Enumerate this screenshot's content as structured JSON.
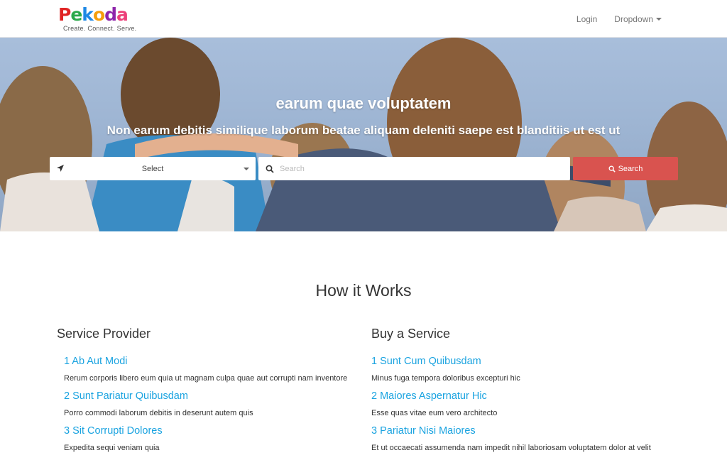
{
  "brand": {
    "letters": [
      {
        "ch": "P",
        "color": "#e02424"
      },
      {
        "ch": "e",
        "color": "#2ba84a"
      },
      {
        "ch": "k",
        "color": "#1e88e5"
      },
      {
        "ch": "o",
        "color": "#f59e0b"
      },
      {
        "ch": "d",
        "color": "#8e24aa"
      },
      {
        "ch": "a",
        "color": "#ec407a"
      }
    ],
    "tagline": "Create. Connect. Serve."
  },
  "nav": {
    "login": "Login",
    "dropdown": "Dropdown"
  },
  "hero": {
    "title": "earum quae voluptatem",
    "subtitle": "Non earum debitis similique laborum beatae aliquam deleniti saepe est blanditiis ut est ut",
    "location_select": "Select",
    "search_placeholder": "Search",
    "search_button": "Search"
  },
  "how": {
    "title": "How it Works",
    "provider": {
      "title": "Service Provider",
      "steps": [
        {
          "title": "1 Ab Aut Modi",
          "desc": "Rerum corporis libero eum quia ut magnam culpa quae aut corrupti nam inventore"
        },
        {
          "title": "2 Sunt Pariatur Quibusdam",
          "desc": "Porro commodi laborum debitis in deserunt autem quis"
        },
        {
          "title": "3 Sit Corrupti Dolores",
          "desc": "Expedita sequi veniam quia"
        }
      ]
    },
    "buyer": {
      "title": "Buy a Service",
      "steps": [
        {
          "title": "1 Sunt Cum Quibusdam",
          "desc": "Minus fuga tempora doloribus excepturi hic"
        },
        {
          "title": "2 Maiores Aspernatur Hic",
          "desc": "Esse quas vitae eum vero architecto"
        },
        {
          "title": "3 Pariatur Nisi Maiores",
          "desc": "Et ut occaecati assumenda nam impedit nihil laboriosam voluptatem dolor at velit"
        }
      ]
    }
  },
  "colors": {
    "accent_blue": "#1aa3e0",
    "search_button": "#d9534f"
  }
}
